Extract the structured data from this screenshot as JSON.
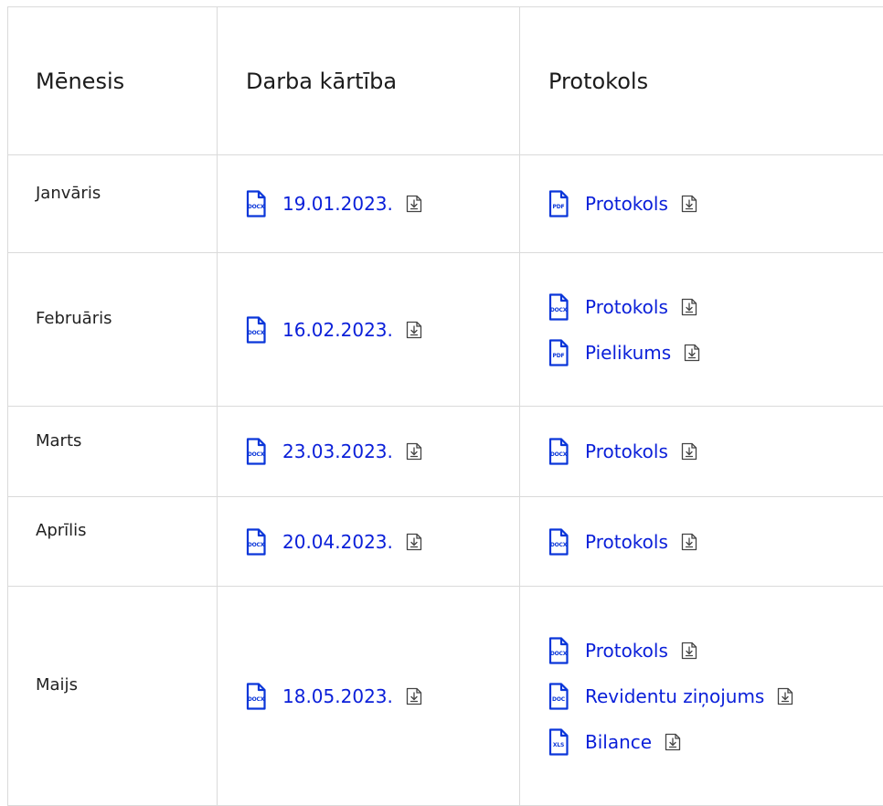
{
  "table": {
    "headers": [
      "Mēnesis",
      "Darba kārtība",
      "Protokols"
    ],
    "rows": [
      {
        "month": "Janvāris",
        "agenda": {
          "label": "19.01.2023.",
          "type": "DOCX"
        },
        "protocols": [
          {
            "label": "Protokols",
            "type": "PDF"
          }
        ]
      },
      {
        "month": "Februāris",
        "agenda": {
          "label": "16.02.2023.",
          "type": "DOCX"
        },
        "protocols": [
          {
            "label": "Protokols",
            "type": "DOCX"
          },
          {
            "label": "Pielikums",
            "type": "PDF"
          }
        ]
      },
      {
        "month": "Marts",
        "agenda": {
          "label": "23.03.2023.",
          "type": "DOCX"
        },
        "protocols": [
          {
            "label": "Protokols",
            "type": "DOCX"
          }
        ]
      },
      {
        "month": "Aprīlis",
        "agenda": {
          "label": "20.04.2023.",
          "type": "DOCX"
        },
        "protocols": [
          {
            "label": "Protokols",
            "type": "DOCX"
          }
        ]
      },
      {
        "month": "Maijs",
        "agenda": {
          "label": "18.05.2023.",
          "type": "DOCX"
        },
        "protocols": [
          {
            "label": "Protokols",
            "type": "DOCX"
          },
          {
            "label": "Revidentu ziņojums",
            "type": "DOC"
          },
          {
            "label": "Bilance",
            "type": "XLS"
          }
        ]
      }
    ]
  },
  "colors": {
    "link": "#0a1fd9",
    "icon": "#0a36d9",
    "border": "#dadada",
    "text": "#1b1b1b"
  },
  "icons": {
    "file": "file-icon",
    "download": "download-icon"
  }
}
